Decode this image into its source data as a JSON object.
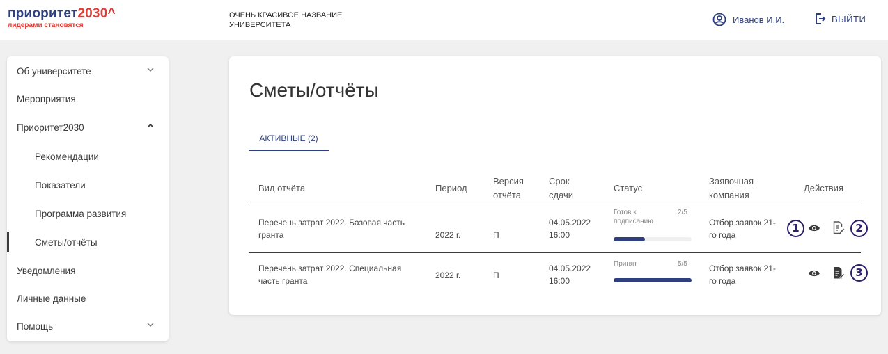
{
  "header": {
    "logo_main": "приоритет",
    "logo_accent": "2030^",
    "logo_sub": "лидерами становятся",
    "university_name": "ОЧЕНЬ КРАСИВОЕ НАЗВАНИЕ УНИВЕРСИТЕТА",
    "user_name": "Иванов И.И.",
    "logout_label": "ВЫЙТИ"
  },
  "sidebar": {
    "items": [
      {
        "label": "Об университете",
        "chevron": "down"
      },
      {
        "label": "Мероприятия"
      },
      {
        "label": "Приоритет2030",
        "chevron": "up"
      },
      {
        "label": "Рекомендации",
        "sub": true
      },
      {
        "label": "Показатели",
        "sub": true
      },
      {
        "label": "Программа развития",
        "sub": true
      },
      {
        "label": "Сметы/отчёты",
        "sub": true,
        "active": true
      },
      {
        "label": "Уведомления"
      },
      {
        "label": "Личные данные"
      },
      {
        "label": "Помощь",
        "chevron": "down"
      }
    ]
  },
  "main": {
    "title": "Сметы/отчёты",
    "tab_active": "АКТИВНЫЕ (2)",
    "columns": {
      "type": "Вид отчёта",
      "period": "Период",
      "version_1": "Версия",
      "version_2": "отчёта",
      "deadline_1": "Срок",
      "deadline_2": "сдачи",
      "status": "Статус",
      "company_1": "Заявочная",
      "company_2": "компания",
      "actions": "Действия"
    },
    "rows": [
      {
        "type_1": "Перечень затрат 2022. Базовая часть",
        "type_2": "гранта",
        "period": "2022 г.",
        "version": "П",
        "date": "04.05.2022",
        "time": "16:00",
        "status_1": "Готов к",
        "status_2": "подписанию",
        "count": "2/5",
        "progress": 0.4,
        "company_1": "Отбор заявок 21-",
        "company_2": "го года",
        "action_icons": [
          "eye-icon",
          "document-sign-icon"
        ]
      },
      {
        "type_1": "Перечень затрат 2022. Специальная",
        "type_2": "часть гранта",
        "period": "2022 г.",
        "version": "П",
        "date": "04.05.2022",
        "time": "16:00",
        "status_1": "Принят",
        "status_2": "",
        "count": "5/5",
        "progress": 1.0,
        "company_1": "Отбор заявок 21-",
        "company_2": "го года",
        "action_icons": [
          "eye-icon",
          "document-signed-icon"
        ]
      }
    ],
    "annotations": [
      "1",
      "2",
      "3"
    ]
  },
  "colors": {
    "brand_blue": "#2e3f7f",
    "brand_red": "#e23b35",
    "badge": "#2e1f6a"
  }
}
